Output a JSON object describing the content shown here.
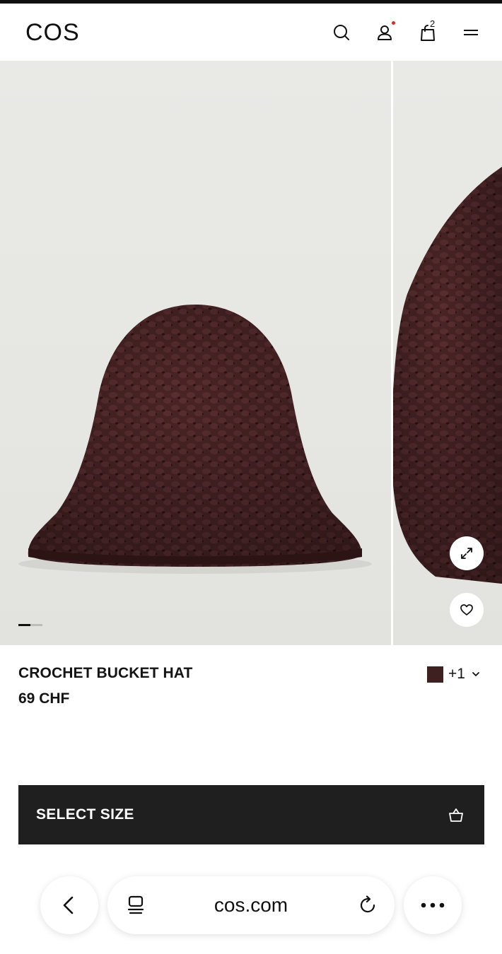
{
  "header": {
    "logo": "COS",
    "bag_count": "2",
    "icons": [
      "search-icon",
      "account-icon",
      "bag-icon",
      "menu-icon"
    ]
  },
  "gallery": {
    "current_slide": 1,
    "slide_progress": 0.5
  },
  "product": {
    "name": "CROCHET BUCKET HAT",
    "price": "69 CHF",
    "swatch_color": "#3e2020",
    "more_colors": "+1"
  },
  "cta": {
    "select_size_label": "SELECT SIZE"
  },
  "browser": {
    "url": "cos.com"
  },
  "colors": {
    "accent_dot": "#d0302b",
    "button_bg": "#1f1f1f",
    "hat": "#4a2426"
  }
}
